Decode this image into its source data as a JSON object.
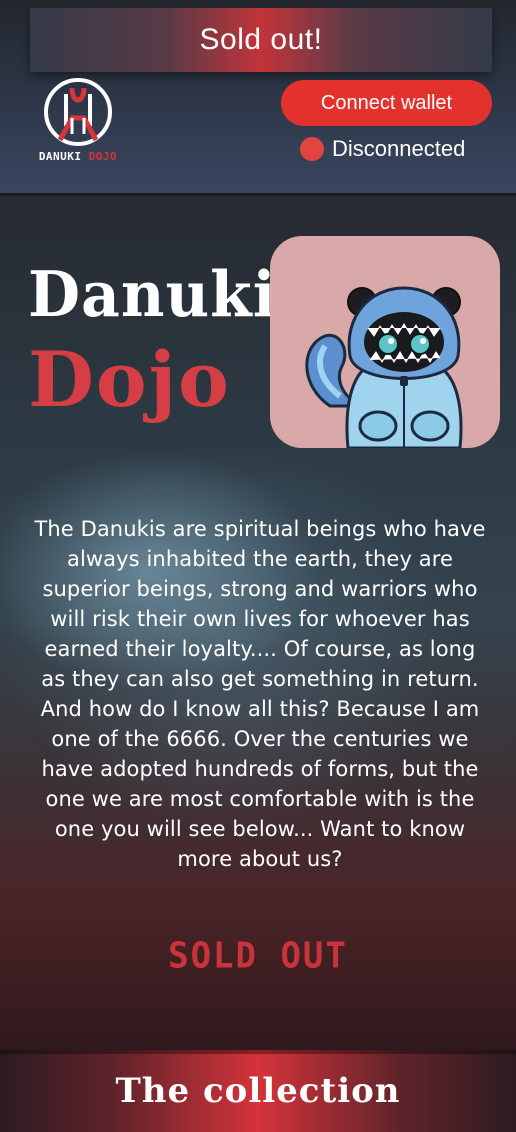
{
  "banner": {
    "text": "Sold out!"
  },
  "header": {
    "logo_caption_white": "DANUKI",
    "logo_caption_red": "DOJO",
    "connect_button": "Connect wallet",
    "status_text": "Disconnected"
  },
  "hero": {
    "title_line1": "Danuki",
    "title_line2": "Dojo"
  },
  "description": "The Danukis are spiritual beings who have always inhabited the earth, they are superior beings, strong and warriors who will risk their own lives for whoever has earned their loyalty.... Of course, as long as they can also get something in return. And how do I know all this? Because I am one of the 6666. Over the centuries we have adopted hundreds of forms, but the one we are most comfortable with is the one you will see below... Want to know more about us?",
  "mint_status": "SOLD OUT",
  "collection": {
    "label": "The collection"
  },
  "colors": {
    "accent_red": "#e3322d",
    "title_red": "#d43e44",
    "status_dot": "#e2453f",
    "mascot_bg": "#d9a8a8"
  },
  "icons": {
    "logo": "danuki-dojo-logo",
    "status": "status-dot-icon",
    "mascot": "danuki-shark-hoodie-image"
  }
}
